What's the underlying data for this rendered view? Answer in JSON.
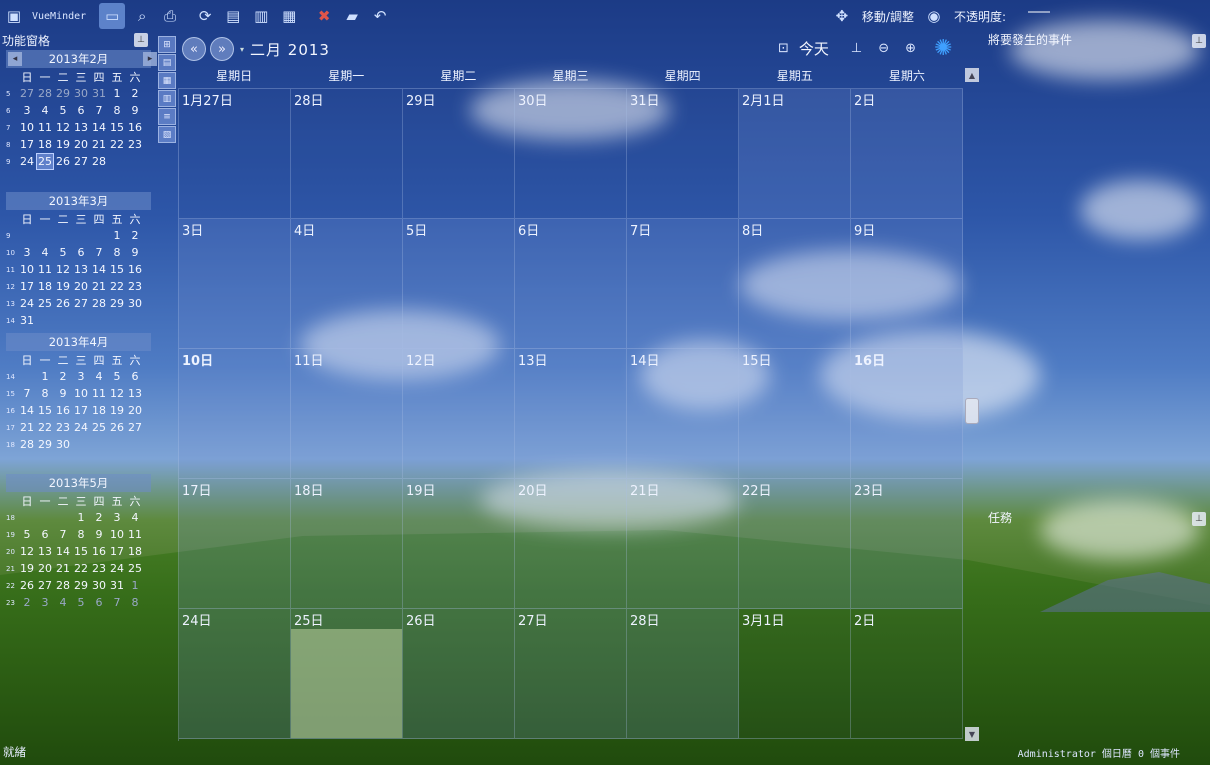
{
  "toolbar": {
    "app_name": "VueMinder",
    "move_resize_label": "移動/調整",
    "opacity_label": "不透明度:"
  },
  "left_panel": {
    "title": "功能窗格",
    "minicals": [
      {
        "header": "2013年2月",
        "days_of_week": [
          "日",
          "一",
          "二",
          "三",
          "四",
          "五",
          "六"
        ],
        "weeks": [
          {
            "wk": "5",
            "days": [
              "27",
              "28",
              "29",
              "30",
              "31",
              "1",
              "2"
            ],
            "dim": [
              true,
              true,
              true,
              true,
              true,
              false,
              false
            ]
          },
          {
            "wk": "6",
            "days": [
              "3",
              "4",
              "5",
              "6",
              "7",
              "8",
              "9"
            ]
          },
          {
            "wk": "7",
            "days": [
              "10",
              "11",
              "12",
              "13",
              "14",
              "15",
              "16"
            ]
          },
          {
            "wk": "8",
            "days": [
              "17",
              "18",
              "19",
              "20",
              "21",
              "22",
              "23"
            ]
          },
          {
            "wk": "9",
            "days": [
              "24",
              "25",
              "26",
              "27",
              "28",
              "",
              ""
            ],
            "sel": 1
          }
        ]
      },
      {
        "header": "2013年3月",
        "days_of_week": [
          "日",
          "一",
          "二",
          "三",
          "四",
          "五",
          "六"
        ],
        "weeks": [
          {
            "wk": "9",
            "days": [
              "",
              "",
              "",
              "",
              "",
              "1",
              "2"
            ]
          },
          {
            "wk": "10",
            "days": [
              "3",
              "4",
              "5",
              "6",
              "7",
              "8",
              "9"
            ]
          },
          {
            "wk": "11",
            "days": [
              "10",
              "11",
              "12",
              "13",
              "14",
              "15",
              "16"
            ]
          },
          {
            "wk": "12",
            "days": [
              "17",
              "18",
              "19",
              "20",
              "21",
              "22",
              "23"
            ]
          },
          {
            "wk": "13",
            "days": [
              "24",
              "25",
              "26",
              "27",
              "28",
              "29",
              "30"
            ]
          },
          {
            "wk": "14",
            "days": [
              "31",
              "",
              "",
              "",
              "",
              "",
              ""
            ]
          }
        ]
      },
      {
        "header": "2013年4月",
        "days_of_week": [
          "日",
          "一",
          "二",
          "三",
          "四",
          "五",
          "六"
        ],
        "weeks": [
          {
            "wk": "14",
            "days": [
              "",
              "1",
              "2",
              "3",
              "4",
              "5",
              "6"
            ]
          },
          {
            "wk": "15",
            "days": [
              "7",
              "8",
              "9",
              "10",
              "11",
              "12",
              "13"
            ]
          },
          {
            "wk": "16",
            "days": [
              "14",
              "15",
              "16",
              "17",
              "18",
              "19",
              "20"
            ]
          },
          {
            "wk": "17",
            "days": [
              "21",
              "22",
              "23",
              "24",
              "25",
              "26",
              "27"
            ]
          },
          {
            "wk": "18",
            "days": [
              "28",
              "29",
              "30",
              "",
              "",
              "",
              ""
            ]
          }
        ]
      },
      {
        "header": "2013年5月",
        "days_of_week": [
          "日",
          "一",
          "二",
          "三",
          "四",
          "五",
          "六"
        ],
        "weeks": [
          {
            "wk": "18",
            "days": [
              "",
              "",
              "",
              "1",
              "2",
              "3",
              "4"
            ]
          },
          {
            "wk": "19",
            "days": [
              "5",
              "6",
              "7",
              "8",
              "9",
              "10",
              "11"
            ]
          },
          {
            "wk": "20",
            "days": [
              "12",
              "13",
              "14",
              "15",
              "16",
              "17",
              "18"
            ]
          },
          {
            "wk": "21",
            "days": [
              "19",
              "20",
              "21",
              "22",
              "23",
              "24",
              "25"
            ]
          },
          {
            "wk": "22",
            "days": [
              "26",
              "27",
              "28",
              "29",
              "30",
              "31",
              "1"
            ],
            "dim": [
              false,
              false,
              false,
              false,
              false,
              false,
              true
            ]
          },
          {
            "wk": "23",
            "days": [
              "2",
              "3",
              "4",
              "5",
              "6",
              "7",
              "8"
            ],
            "dim": [
              true,
              true,
              true,
              true,
              true,
              true,
              true
            ]
          }
        ]
      }
    ]
  },
  "calendar": {
    "title": "二月 2013",
    "today_label": "今天",
    "days_of_week": [
      "星期日",
      "星期一",
      "星期二",
      "星期三",
      "星期四",
      "星期五",
      "星期六"
    ],
    "cells": [
      "1月27日",
      "28日",
      "29日",
      "30日",
      "31日",
      "2月1日",
      "2日",
      "3日",
      "4日",
      "5日",
      "6日",
      "7日",
      "8日",
      "9日",
      "10日",
      "11日",
      "12日",
      "13日",
      "14日",
      "15日",
      "16日",
      "17日",
      "18日",
      "19日",
      "20日",
      "21日",
      "22日",
      "23日",
      "24日",
      "25日",
      "26日",
      "27日",
      "28日",
      "3月1日",
      "2日"
    ],
    "today_index": 29
  },
  "right_panel": {
    "upcoming_title": "將要發生的事件",
    "tasks_title": "任務"
  },
  "status": {
    "left": "就緒",
    "right": "Administrator 個日曆 0 個事件"
  }
}
